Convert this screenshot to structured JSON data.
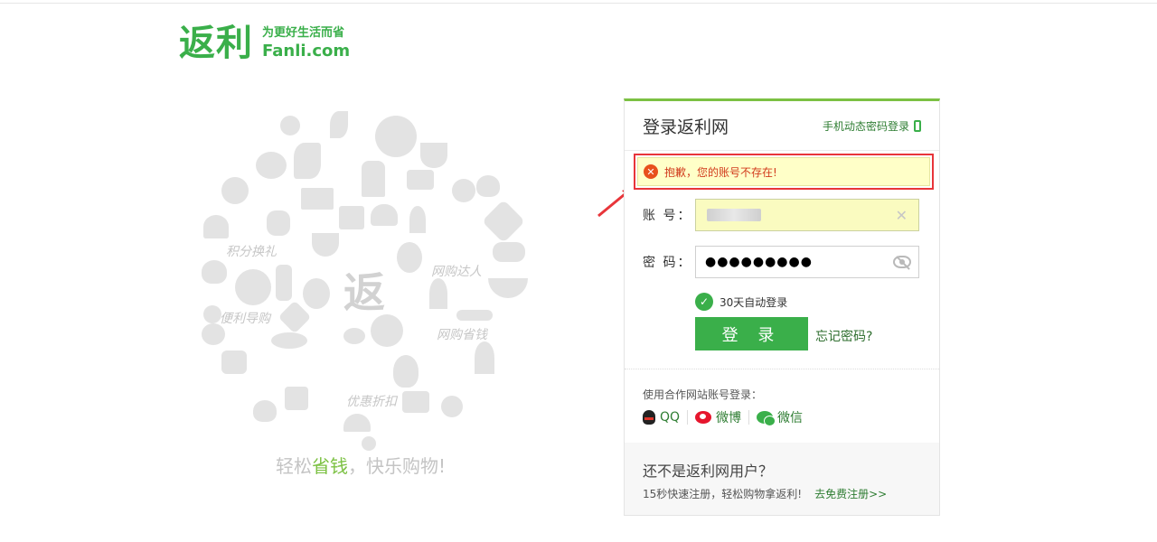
{
  "logo": {
    "main": "返利",
    "slogan": "为更好生活而省",
    "domain": "Fanli.com"
  },
  "illustration": {
    "center": "返",
    "labels": [
      "积分换礼",
      "网购达人",
      "便利导购",
      "网购省钱",
      "优惠折扣"
    ]
  },
  "tagline": {
    "prefix": "轻松",
    "highlight": "省钱",
    "suffix": "，快乐购物!"
  },
  "login": {
    "title": "登录返利网",
    "mobile_login": "手机动态密码登录",
    "error": "抱歉，您的账号不存在!",
    "account_label": "账 号：",
    "password_label": "密 码：",
    "password_value": "●●●●●●●●●",
    "auto_login": "30天自动登录",
    "login_button": "登 录",
    "forgot": "忘记密码?",
    "partner_title": "使用合作网站账号登录：",
    "partners": [
      {
        "name": "QQ",
        "icon": "qq-icon"
      },
      {
        "name": "微博",
        "icon": "weibo-icon"
      },
      {
        "name": "微信",
        "icon": "wechat-icon"
      }
    ],
    "footer_title": "还不是返利网用户？",
    "footer_text": "15秒快速注册，轻松购物拿返利!",
    "register_link": "去免费注册>>"
  },
  "colors": {
    "brand_green": "#3aaf4a",
    "accent_green": "#7cc143",
    "error_red": "#e8353a"
  }
}
